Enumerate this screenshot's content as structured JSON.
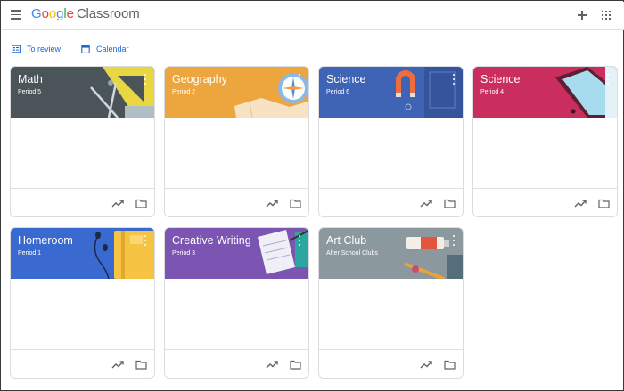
{
  "header": {
    "menu_icon": "hamburger-menu-icon",
    "brand_letters": [
      "G",
      "o",
      "o",
      "g",
      "l",
      "e"
    ],
    "brand_colors": [
      "#4285f4",
      "#ea4335",
      "#fbbc05",
      "#4285f4",
      "#34a853",
      "#ea4335"
    ],
    "product": "Classroom",
    "create_icon": "plus-icon",
    "apps_icon": "apps-grid-icon"
  },
  "toolbar": {
    "to_review": "To review",
    "calendar": "Calendar",
    "link_color": "#1967d2"
  },
  "classes": [
    {
      "title": "Math",
      "section": "Period 5",
      "color": "#4a5459"
    },
    {
      "title": "Geography",
      "section": "Period 2",
      "color": "#eda63e"
    },
    {
      "title": "Science",
      "section": "Period 6",
      "color": "#3f63b5"
    },
    {
      "title": "Science",
      "section": "Period 4",
      "color": "#c92e5e"
    },
    {
      "title": "Homeroom",
      "section": "Period 1",
      "color": "#3a69d0"
    },
    {
      "title": "Creative Writing",
      "section": "Period 3",
      "color": "#7b55b1"
    },
    {
      "title": "Art Club",
      "section": "After School Clubs",
      "color": "#8b989e"
    }
  ]
}
